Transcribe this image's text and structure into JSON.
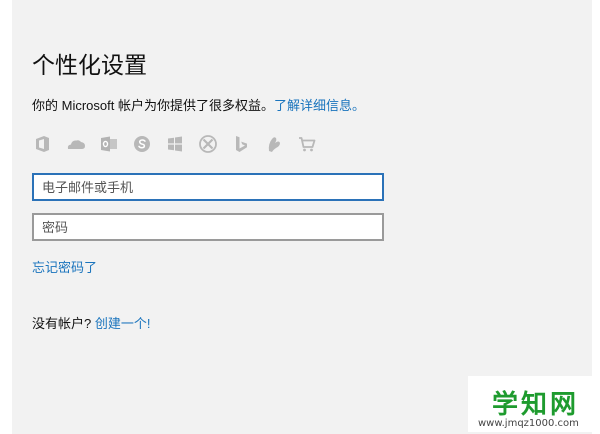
{
  "page": {
    "title": "个性化设置",
    "description": {
      "prefix": "你的 Microsoft 帐户为你提供了很多权益。",
      "link": "了解详细信息。"
    },
    "services": [
      {
        "icon": "office-icon"
      },
      {
        "icon": "onedrive-icon"
      },
      {
        "icon": "outlook-icon"
      },
      {
        "icon": "skype-icon"
      },
      {
        "icon": "windows-icon"
      },
      {
        "icon": "xbox-icon"
      },
      {
        "icon": "bing-icon"
      },
      {
        "icon": "msn-icon"
      },
      {
        "icon": "store-icon"
      }
    ],
    "email": {
      "placeholder": "电子邮件或手机",
      "value": ""
    },
    "password": {
      "placeholder": "密码",
      "value": ""
    },
    "forgot_link": "忘记密码了",
    "signup": {
      "prompt": "没有帐户? ",
      "link": "创建一个!"
    }
  },
  "watermark": {
    "logo": "学知网",
    "url": "www.jmqz1000.com"
  },
  "colors": {
    "accent": "#1a74bd",
    "focus_border": "#2b72b8",
    "icon_gray": "#b8b8b8",
    "watermark_green": "#1e9b2e"
  }
}
